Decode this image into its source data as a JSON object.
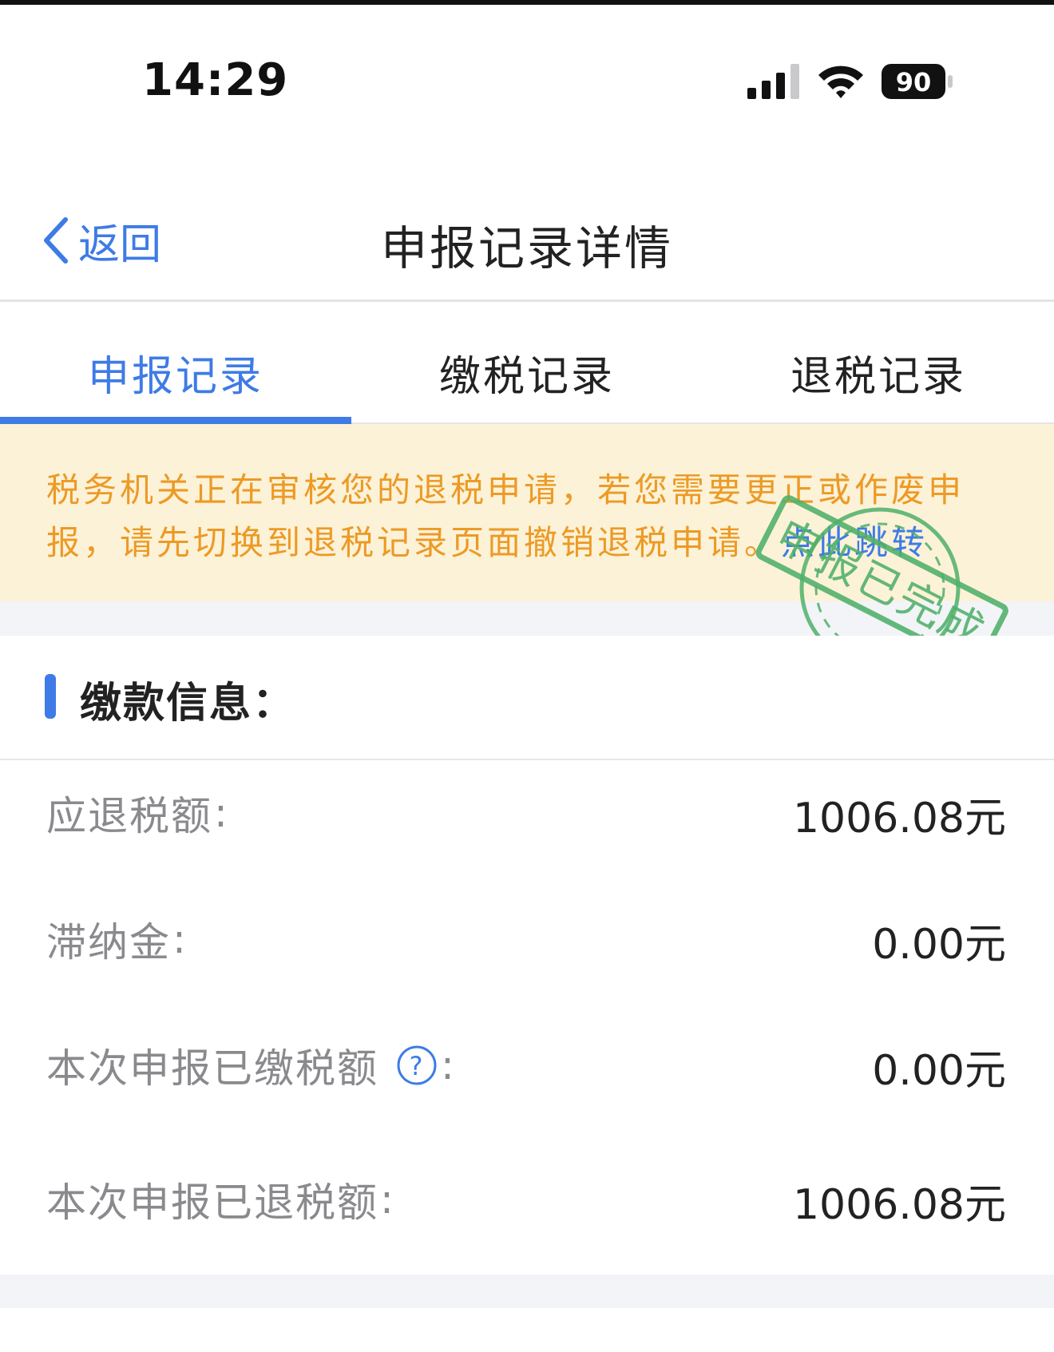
{
  "status_bar": {
    "time": "14:29",
    "battery": "90"
  },
  "nav": {
    "back_label": "返回",
    "title": "申报记录详情"
  },
  "tabs": [
    {
      "label": "申报记录",
      "active": true
    },
    {
      "label": "缴税记录",
      "active": false
    },
    {
      "label": "退税记录",
      "active": false
    }
  ],
  "notice": {
    "text": "税务机关正在审核您的退税申请，若您需要更正或作废申报，请先切换到退税记录页面撤销退税申请。",
    "link": "点此跳转"
  },
  "stamp": {
    "text": "申报已完成"
  },
  "payment_info": {
    "title": "缴款信息：",
    "rows": [
      {
        "label": "应退税额",
        "colon": ":",
        "value": "1006.08元"
      },
      {
        "label": "滞纳金",
        "colon": ":",
        "value": "0.00元"
      },
      {
        "label": "本次申报已缴税额",
        "colon": ":",
        "value": "0.00元",
        "help": "?"
      },
      {
        "label": "本次申报已退税额",
        "colon": ":",
        "value": "1006.08元"
      }
    ]
  },
  "colors": {
    "accent": "#3e7be6",
    "notice_bg": "#fcf2d7",
    "notice_text": "#ec9a26",
    "stamp": "#4fb06a"
  }
}
